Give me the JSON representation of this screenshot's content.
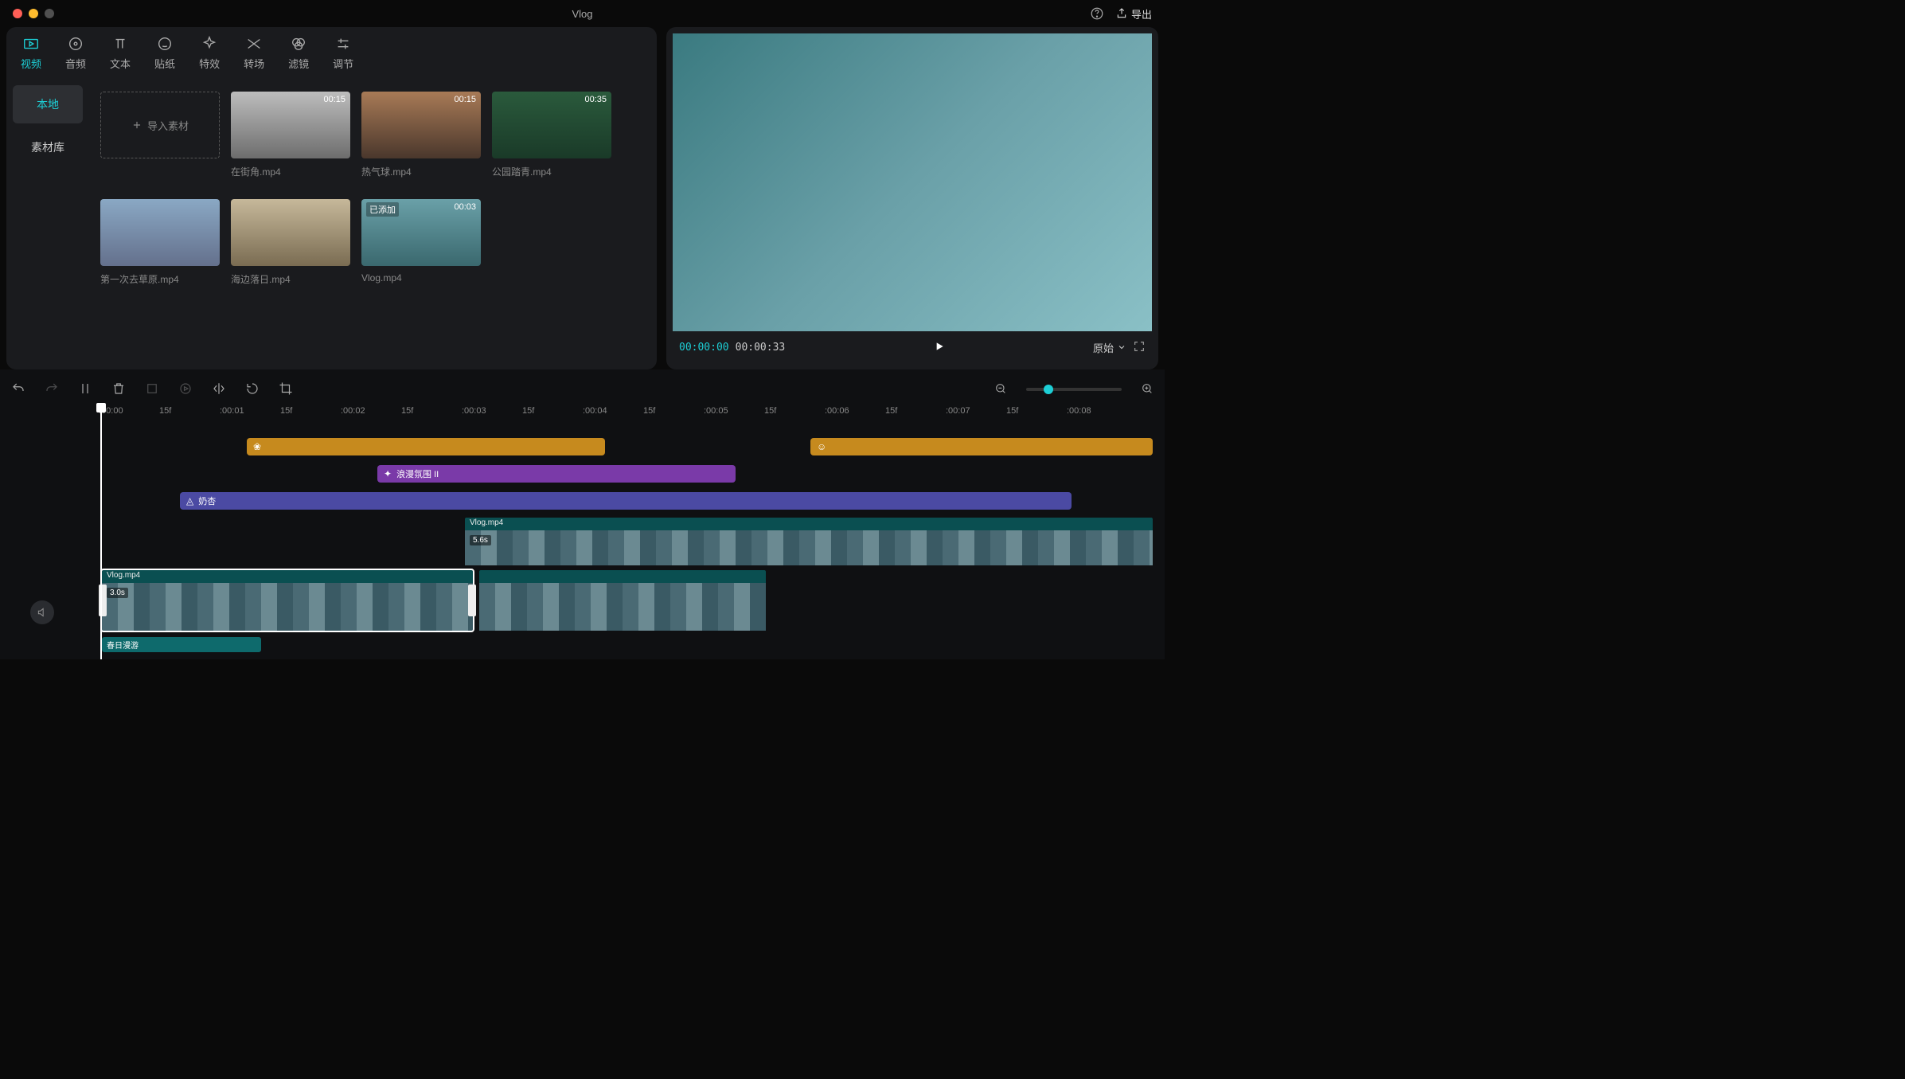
{
  "title": "Vlog",
  "export_label": "导出",
  "top_tabs": [
    {
      "label": "视频",
      "icon": "video-icon"
    },
    {
      "label": "音频",
      "icon": "audio-icon"
    },
    {
      "label": "文本",
      "icon": "text-icon"
    },
    {
      "label": "贴纸",
      "icon": "sticker-icon"
    },
    {
      "label": "特效",
      "icon": "effect-icon"
    },
    {
      "label": "转场",
      "icon": "transition-icon"
    },
    {
      "label": "滤镜",
      "icon": "filter-icon"
    },
    {
      "label": "调节",
      "icon": "adjust-icon"
    }
  ],
  "side_tabs": {
    "local": "本地",
    "library": "素材库"
  },
  "import_label": "导入素材",
  "media": [
    {
      "name": "在街角.mp4",
      "dur": "00:15",
      "cls": "th1"
    },
    {
      "name": "热气球.mp4",
      "dur": "00:15",
      "cls": "th2"
    },
    {
      "name": "公园踏青.mp4",
      "dur": "00:35",
      "cls": "th3"
    },
    {
      "name": "第一次去草原.mp4",
      "cls": "th4"
    },
    {
      "name": "海边落日.mp4",
      "cls": "th5"
    },
    {
      "name": "Vlog.mp4",
      "dur": "00:03",
      "added": "已添加",
      "cls": "th6"
    }
  ],
  "preview": {
    "current": "00:00:00",
    "total": "00:00:33",
    "ratio": "原始"
  },
  "ruler": [
    ":00:00",
    "15f",
    ":00:01",
    "15f",
    ":00:02",
    "15f",
    ":00:03",
    "15f",
    ":00:04",
    "15f",
    ":00:05",
    "15f",
    ":00:06",
    "15f",
    ":00:07",
    "15f",
    ":00:08"
  ],
  "clips": {
    "sticker1": "",
    "sticker2": "",
    "effect": "浪漫氛围 II",
    "filter": "奶杏",
    "vlog_upper": {
      "name": "Vlog.mp4",
      "dur": "5.6s"
    },
    "vlog_lower": {
      "name": "Vlog.mp4",
      "dur": "3.0s"
    },
    "audio": "春日漫游"
  }
}
